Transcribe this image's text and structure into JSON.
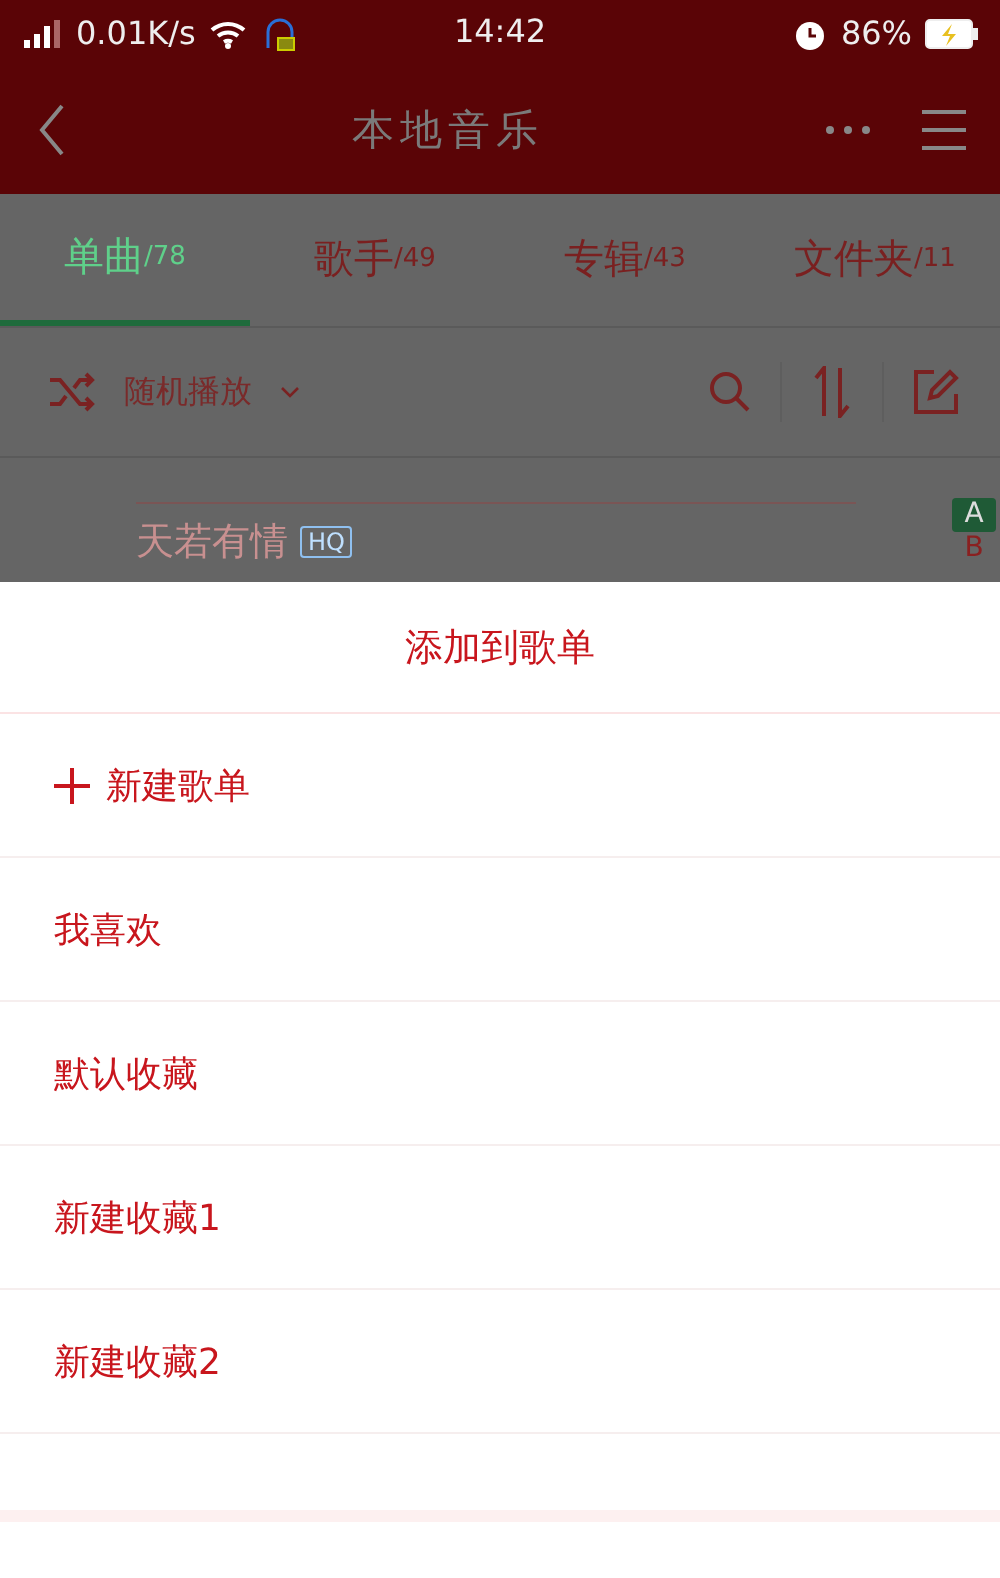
{
  "status_bar": {
    "network_speed": "0.01K/s",
    "time": "14:42",
    "battery": "86%"
  },
  "header": {
    "title": "本地音乐"
  },
  "tabs": [
    {
      "label": "单曲",
      "count": "/78",
      "selected": true
    },
    {
      "label": "歌手",
      "count": "/49",
      "selected": false
    },
    {
      "label": "专辑",
      "count": "/43",
      "selected": false
    },
    {
      "label": "文件夹",
      "count": "/11",
      "selected": false
    }
  ],
  "toolbar": {
    "play_mode": "随机播放"
  },
  "songs": [
    {
      "title": "天若有情",
      "badge": "HQ"
    }
  ],
  "index_letters": [
    {
      "letter": "A",
      "selected": true
    },
    {
      "letter": "B",
      "selected": false
    }
  ],
  "sheet": {
    "title": "添加到歌单",
    "new_playlist": "新建歌单",
    "playlists": [
      "我喜欢",
      "默认收藏",
      "新建收藏1",
      "新建收藏2"
    ]
  }
}
